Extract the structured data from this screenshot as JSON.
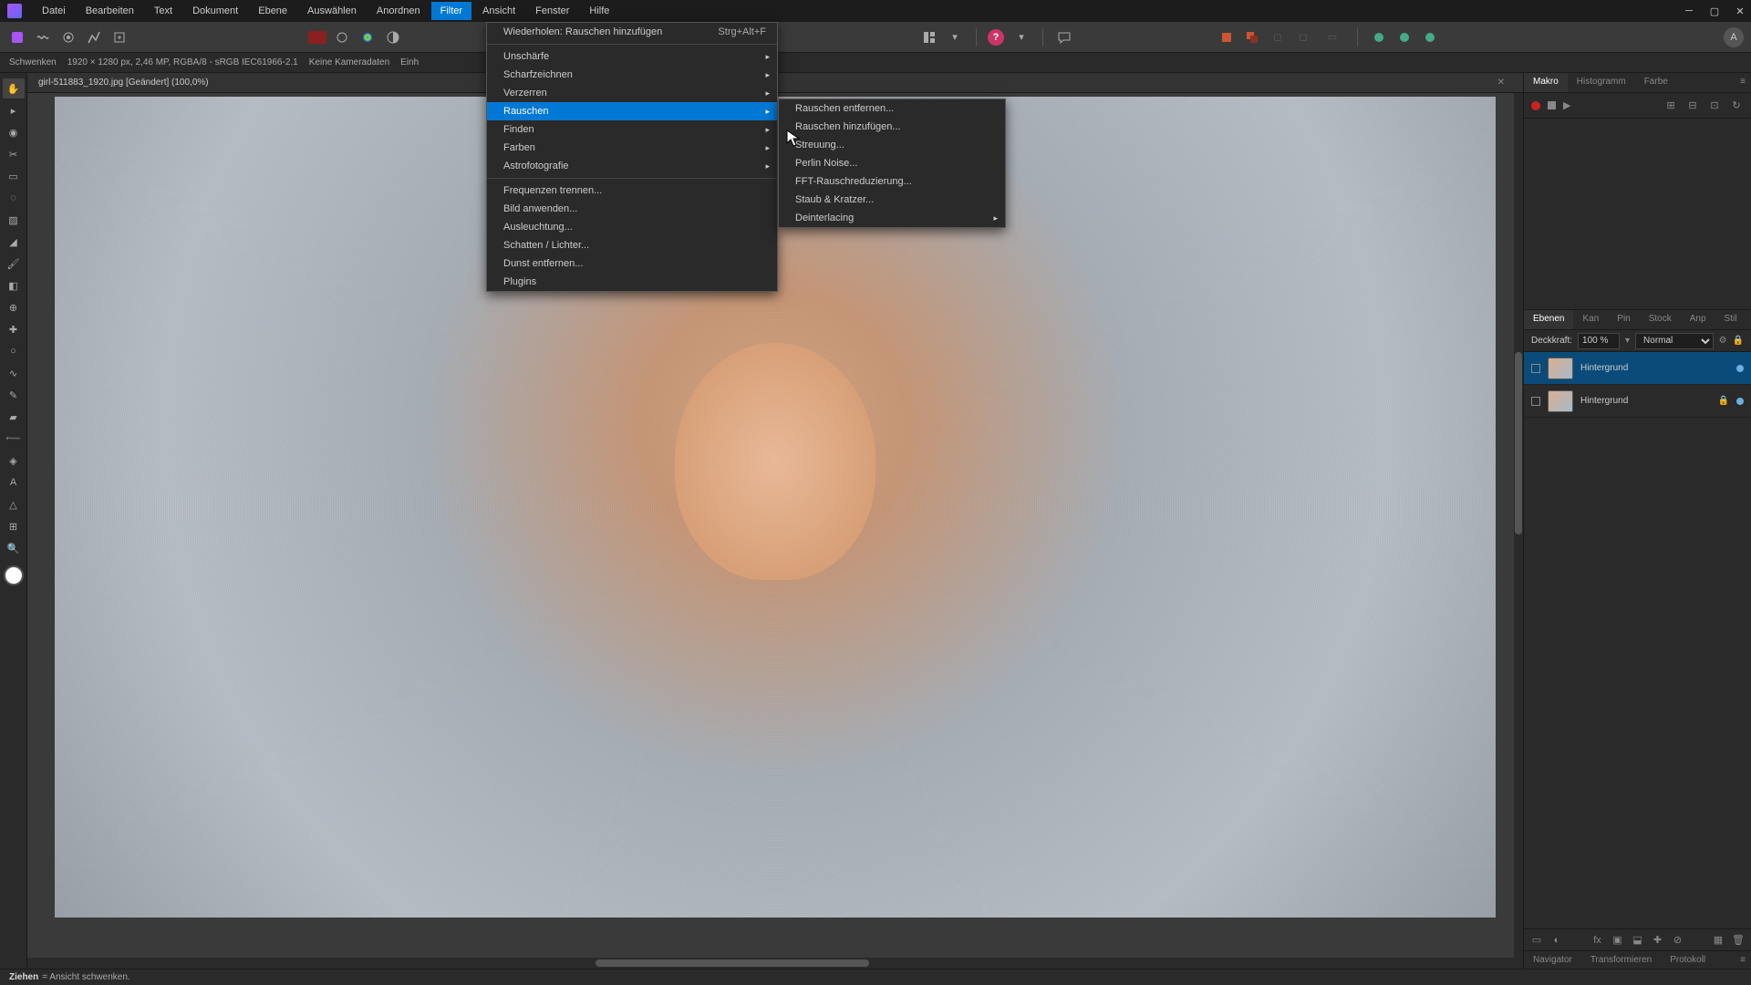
{
  "menubar": [
    "Datei",
    "Bearbeiten",
    "Text",
    "Dokument",
    "Ebene",
    "Auswählen",
    "Anordnen",
    "Filter",
    "Ansicht",
    "Fenster",
    "Hilfe"
  ],
  "active_menu_index": 7,
  "contextbar": {
    "tool": "Schwenken",
    "dims": "1920 × 1280 px, 2,46 MP, RGBA/8 - sRGB IEC61966-2.1",
    "meta": "Keine Kameradaten",
    "einh": "Einh"
  },
  "doc_tab": "girl-511883_1920.jpg [Geändert] (100,0%)",
  "filter_menu": {
    "repeat": {
      "label": "Wiederholen: Rauschen hinzufügen",
      "shortcut": "Strg+Alt+F"
    },
    "items": [
      {
        "label": "Unschärfe",
        "sub": true
      },
      {
        "label": "Scharfzeichnen",
        "sub": true
      },
      {
        "label": "Verzerren",
        "sub": true
      },
      {
        "label": "Rauschen",
        "sub": true,
        "hover": true
      },
      {
        "label": "Finden",
        "sub": true
      },
      {
        "label": "Farben",
        "sub": true
      },
      {
        "label": "Astrofotografie",
        "sub": true
      }
    ],
    "items2": [
      {
        "label": "Frequenzen trennen..."
      },
      {
        "label": "Bild anwenden..."
      },
      {
        "label": "Ausleuchtung..."
      },
      {
        "label": "Schatten / Lichter..."
      },
      {
        "label": "Dunst entfernen..."
      },
      {
        "label": "Plugins"
      }
    ]
  },
  "rauschen_menu": [
    {
      "label": "Rauschen entfernen..."
    },
    {
      "label": "Rauschen hinzufügen..."
    },
    {
      "label": "Streuung..."
    },
    {
      "label": "Perlin Noise..."
    },
    {
      "label": "FFT-Rauschreduzierung..."
    },
    {
      "label": "Staub & Kratzer..."
    },
    {
      "label": "Deinterlacing",
      "sub": true
    }
  ],
  "right": {
    "tabs_top": [
      "Makro",
      "Histogramm",
      "Farbe"
    ],
    "tabs_layers": [
      "Ebenen",
      "Kan",
      "Pin",
      "Stock",
      "Anp",
      "Stil"
    ],
    "opacity_label": "Deckkraft:",
    "opacity_value": "100 %",
    "blend_mode": "Normal",
    "layers": [
      {
        "name": "Hintergrund",
        "selected": true,
        "visible": true,
        "locked": false
      },
      {
        "name": "Hintergrund",
        "selected": false,
        "visible": true,
        "locked": true
      }
    ],
    "tabs_bottom": [
      "Navigator",
      "Transformieren",
      "Protokoll"
    ]
  },
  "status": {
    "bold": "Ziehen",
    "rest": "= Ansicht schwenken."
  },
  "user_badge": "A"
}
